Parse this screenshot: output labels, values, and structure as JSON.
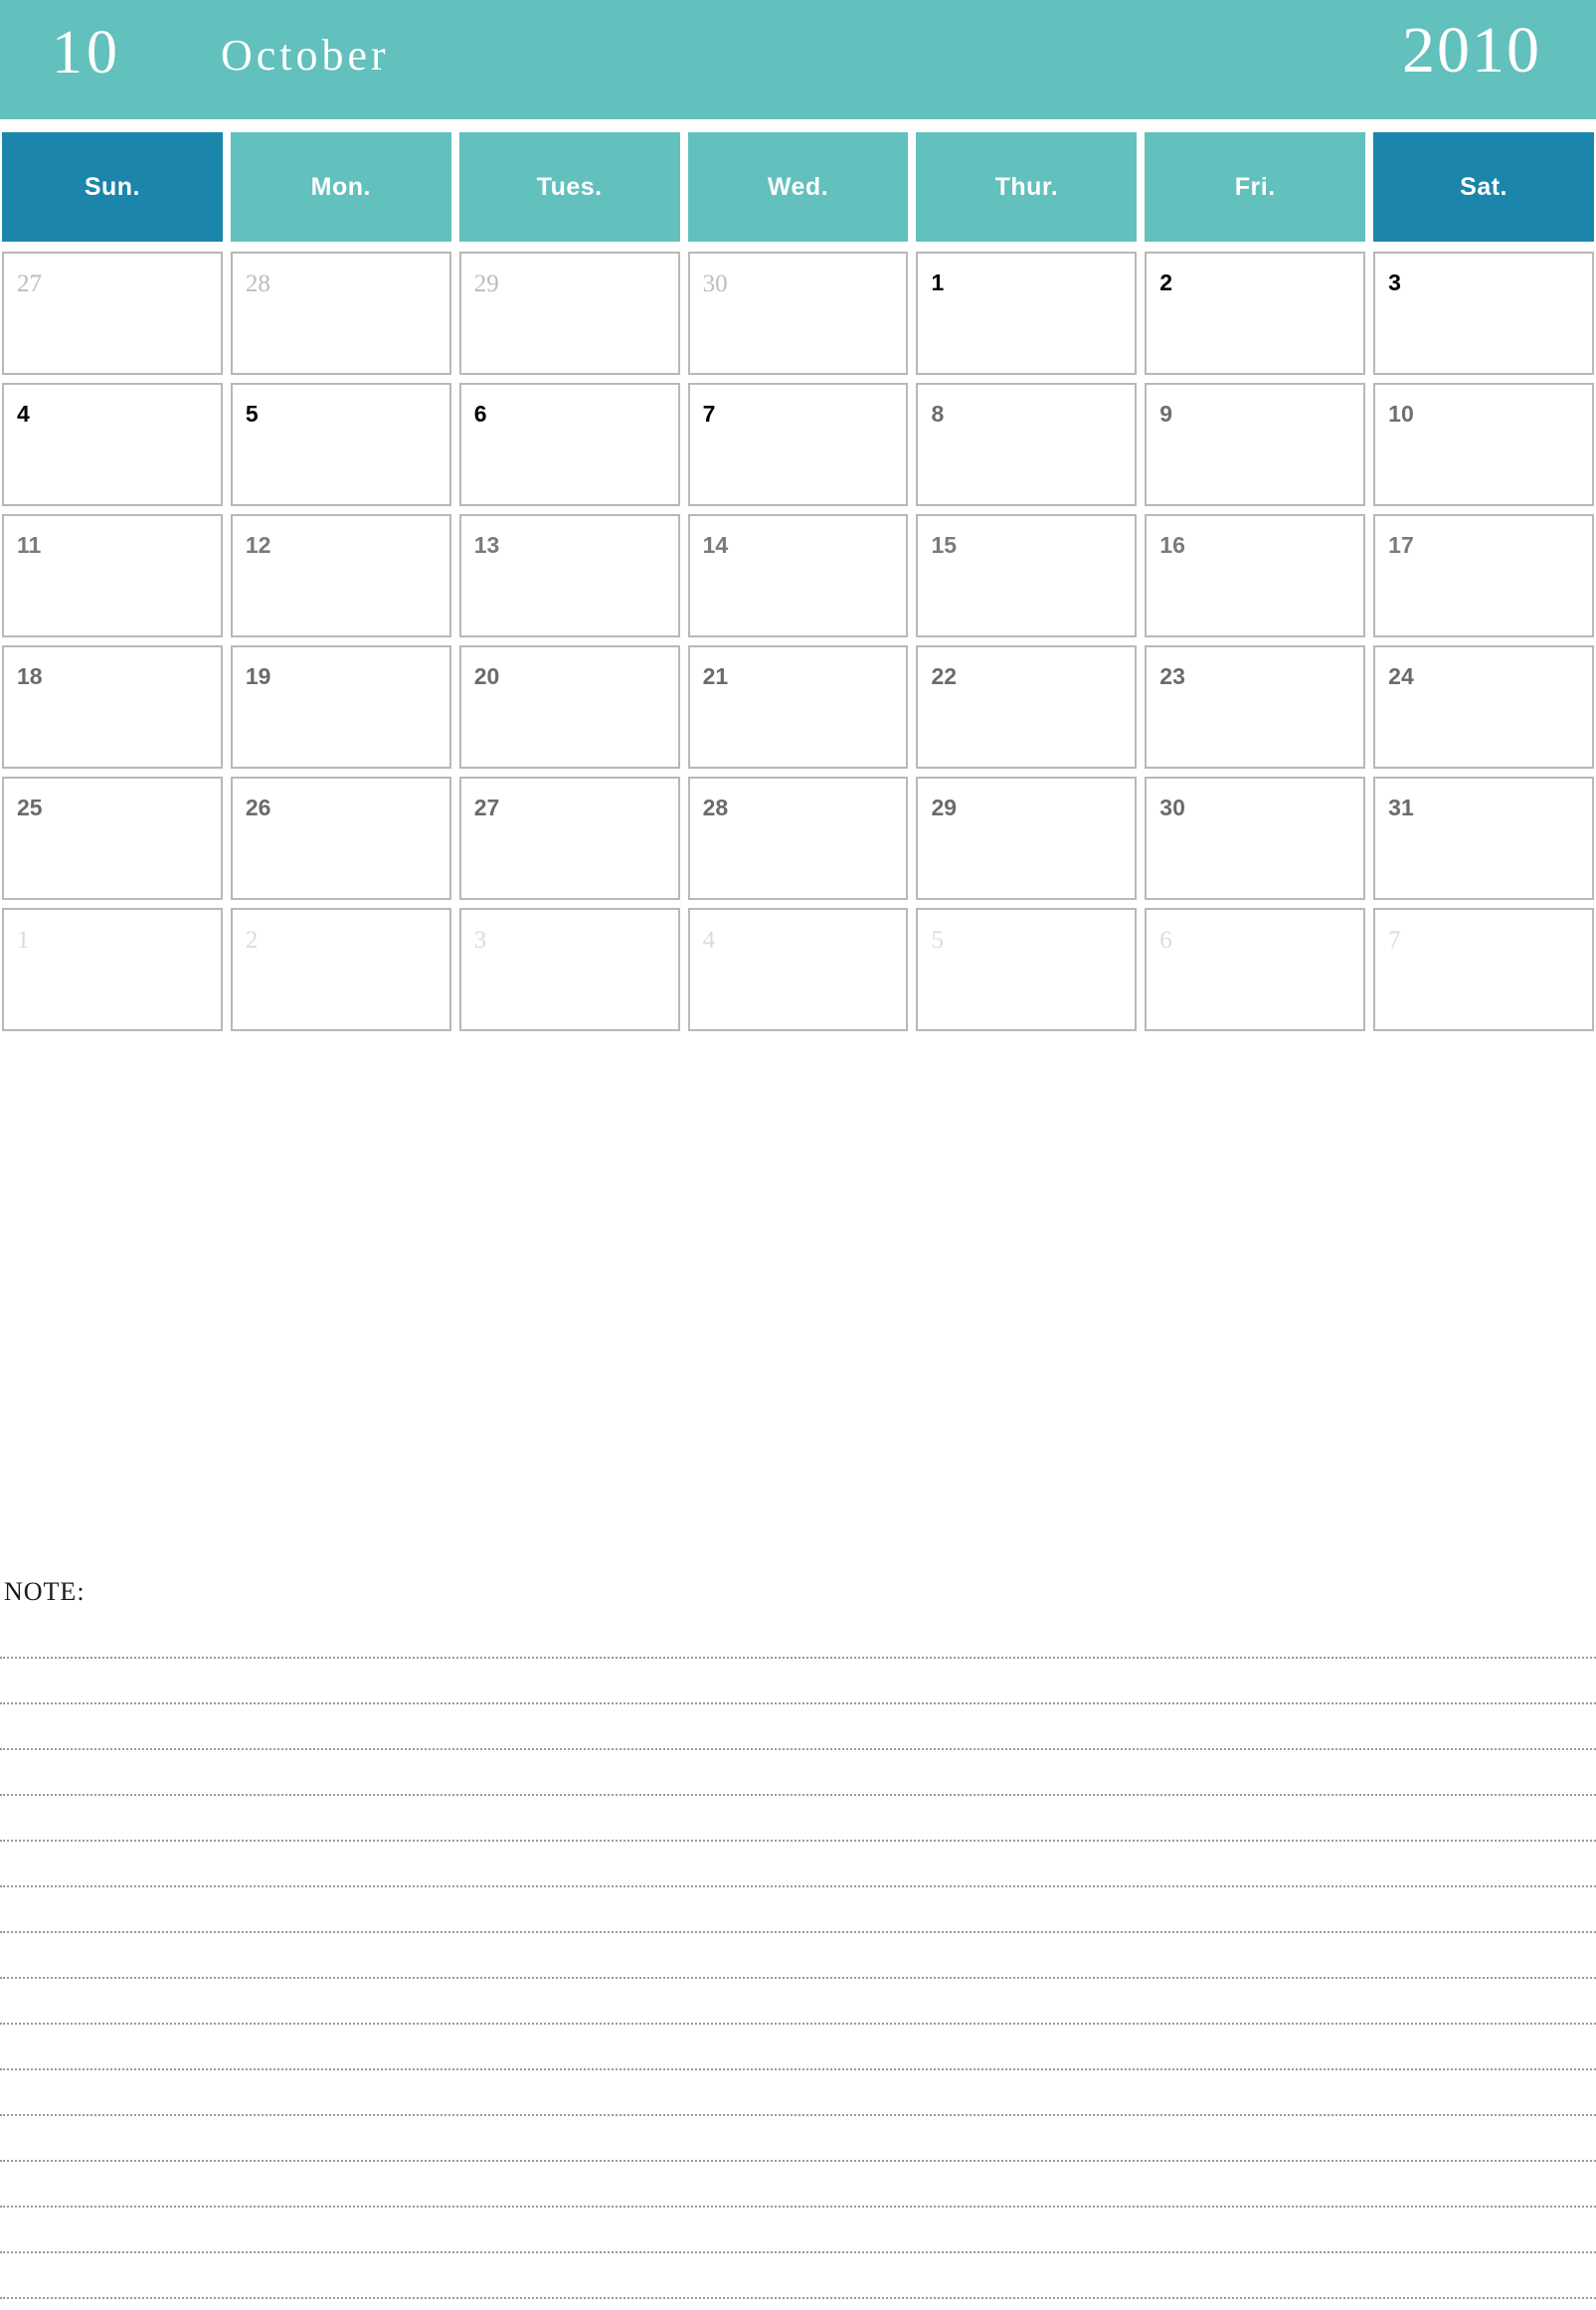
{
  "header": {
    "month_number": "10",
    "month_name": "October",
    "year": "2010",
    "background_color": "#62c0bd",
    "text_color": "#ffffff"
  },
  "weekdays": [
    {
      "label": "Sun.",
      "weekend": true,
      "color": "#1c85ab"
    },
    {
      "label": "Mon.",
      "weekend": false,
      "color": "#62c0bd"
    },
    {
      "label": "Tues.",
      "weekend": false,
      "color": "#62c0bd"
    },
    {
      "label": "Wed.",
      "weekend": false,
      "color": "#62c0bd"
    },
    {
      "label": "Thur.",
      "weekend": false,
      "color": "#62c0bd"
    },
    {
      "label": "Fri.",
      "weekend": false,
      "color": "#62c0bd"
    },
    {
      "label": "Sat.",
      "weekend": true,
      "color": "#1c85ab"
    }
  ],
  "weeks": [
    [
      {
        "day": "27",
        "kind": "out"
      },
      {
        "day": "28",
        "kind": "out"
      },
      {
        "day": "29",
        "kind": "out"
      },
      {
        "day": "30",
        "kind": "out"
      },
      {
        "day": "1",
        "kind": "t1"
      },
      {
        "day": "2",
        "kind": "t1"
      },
      {
        "day": "3",
        "kind": "t1"
      }
    ],
    [
      {
        "day": "4",
        "kind": "t1"
      },
      {
        "day": "5",
        "kind": "t1"
      },
      {
        "day": "6",
        "kind": "t1"
      },
      {
        "day": "7",
        "kind": "t1"
      },
      {
        "day": "8",
        "kind": "t3"
      },
      {
        "day": "9",
        "kind": "t3"
      },
      {
        "day": "10",
        "kind": "t3"
      }
    ],
    [
      {
        "day": "11",
        "kind": "t4"
      },
      {
        "day": "12",
        "kind": "t4"
      },
      {
        "day": "13",
        "kind": "t4"
      },
      {
        "day": "14",
        "kind": "t4"
      },
      {
        "day": "15",
        "kind": "t4"
      },
      {
        "day": "16",
        "kind": "t4"
      },
      {
        "day": "17",
        "kind": "t4"
      }
    ],
    [
      {
        "day": "18",
        "kind": "t5"
      },
      {
        "day": "19",
        "kind": "t5"
      },
      {
        "day": "20",
        "kind": "t5"
      },
      {
        "day": "21",
        "kind": "t5"
      },
      {
        "day": "22",
        "kind": "t5"
      },
      {
        "day": "23",
        "kind": "t5"
      },
      {
        "day": "24",
        "kind": "t5"
      }
    ],
    [
      {
        "day": "25",
        "kind": "t5"
      },
      {
        "day": "26",
        "kind": "t5"
      },
      {
        "day": "27",
        "kind": "t5"
      },
      {
        "day": "28",
        "kind": "t5"
      },
      {
        "day": "29",
        "kind": "t5"
      },
      {
        "day": "30",
        "kind": "t5"
      },
      {
        "day": "31",
        "kind": "t5"
      }
    ],
    [
      {
        "day": "1",
        "kind": "out-faint"
      },
      {
        "day": "2",
        "kind": "out-faint"
      },
      {
        "day": "3",
        "kind": "out-faint"
      },
      {
        "day": "4",
        "kind": "out-faint"
      },
      {
        "day": "5",
        "kind": "out-faint"
      },
      {
        "day": "6",
        "kind": "out-faint"
      },
      {
        "day": "7",
        "kind": "out-faint"
      }
    ]
  ],
  "note": {
    "label": "NOTE:",
    "line_count": 15
  },
  "colors": {
    "accent_teal": "#62c0bd",
    "accent_blue": "#1c85ab",
    "cell_border": "#b8b8b8",
    "note_line": "#9a9a9a"
  }
}
